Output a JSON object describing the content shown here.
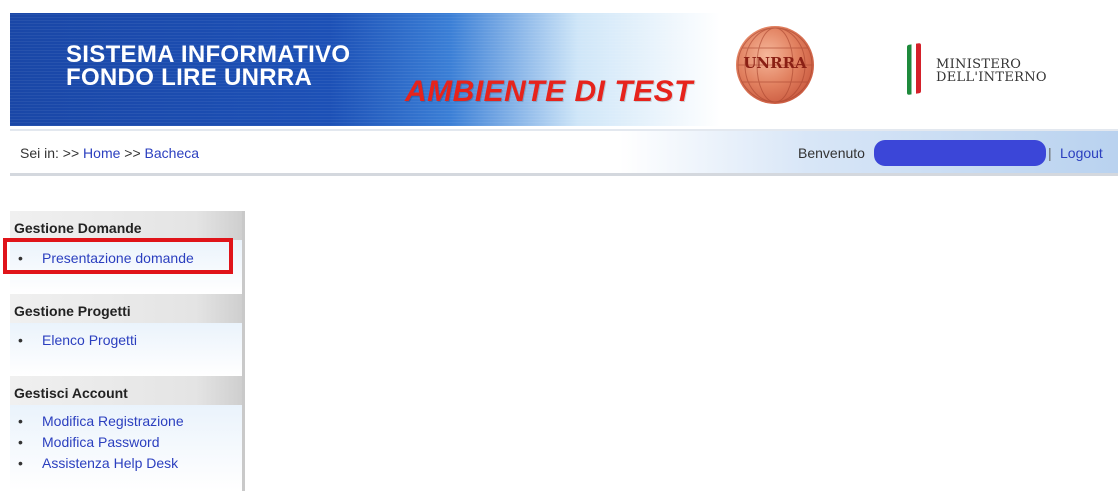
{
  "header": {
    "title_line1": "SISTEMA INFORMATIVO",
    "title_line2": "FONDO LIRE UNRRA",
    "environment": "AMBIENTE DI TEST",
    "logo_text": "UNRRA",
    "ministry_line1": "MINISTERO",
    "ministry_line2": "DELL'INTERNO"
  },
  "breadcrumb": {
    "prefix": "Sei in: >>",
    "home": "Home",
    "separator": ">>",
    "current": "Bacheca"
  },
  "user_bar": {
    "welcome": "Benvenuto",
    "separator": "|",
    "logout": "Logout"
  },
  "sidebar": {
    "sections": [
      {
        "title": "Gestione Domande",
        "items": [
          "Presentazione domande"
        ]
      },
      {
        "title": "Gestione Progetti",
        "items": [
          "Elenco Progetti"
        ]
      },
      {
        "title": "Gestisci Account",
        "items": [
          "Modifica Registrazione",
          "Modifica Password",
          "Assistenza Help Desk"
        ]
      }
    ]
  },
  "colors": {
    "banner_blue": "#1c50b6",
    "test_red": "#e6231c",
    "link_blue": "#2b3fbf",
    "highlight_red": "#e0141a",
    "user_pill": "#3b46d8"
  }
}
